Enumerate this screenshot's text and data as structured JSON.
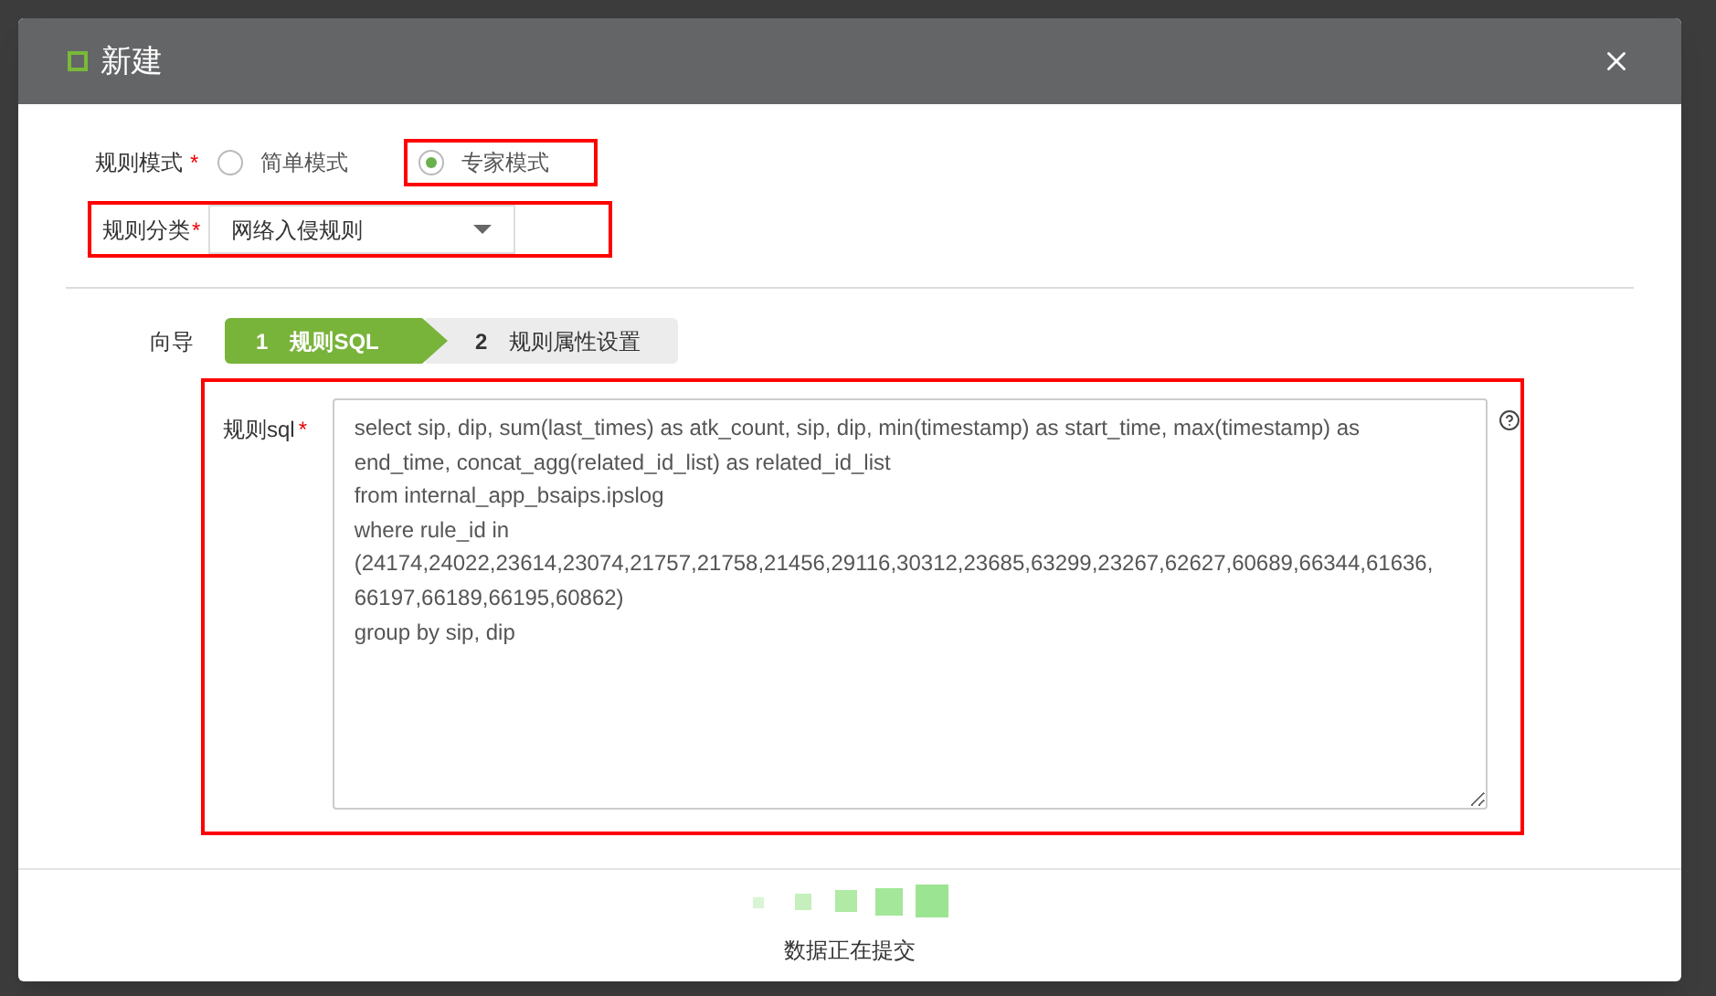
{
  "dialog": {
    "title": "新建"
  },
  "rule_mode": {
    "label": "规则模式",
    "required_mark": "*",
    "options": [
      {
        "label": "简单模式",
        "selected": false,
        "highlighted": false
      },
      {
        "label": "专家模式",
        "selected": true,
        "highlighted": true
      }
    ]
  },
  "category": {
    "label": "规则分类",
    "required_mark": "*",
    "value": "网络入侵规则",
    "highlighted": true
  },
  "wizard": {
    "label": "向导",
    "steps": [
      {
        "number": "1",
        "label": "规则SQL",
        "selected": true
      },
      {
        "number": "2",
        "label": "规则属性设置",
        "selected": false
      }
    ]
  },
  "sql": {
    "label": "规则sql",
    "required_mark": "*",
    "highlighted": true,
    "lines": [
      "select sip, dip, sum(last_times) as atk_count, sip, dip, min(timestamp) as start_time, max(timestamp) as",
      "end_time, concat_agg(related_id_list) as related_id_list",
      "from internal_app_bsaips.ipslog",
      "where rule_id in",
      "(24174,24022,23614,23074,21757,21758,21456,29116,30312,23685,63299,23267,62627,60689,66344,61636,",
      "66197,66189,66195,60862)",
      "group by sip, dip"
    ]
  },
  "status": "数据正在提交"
}
